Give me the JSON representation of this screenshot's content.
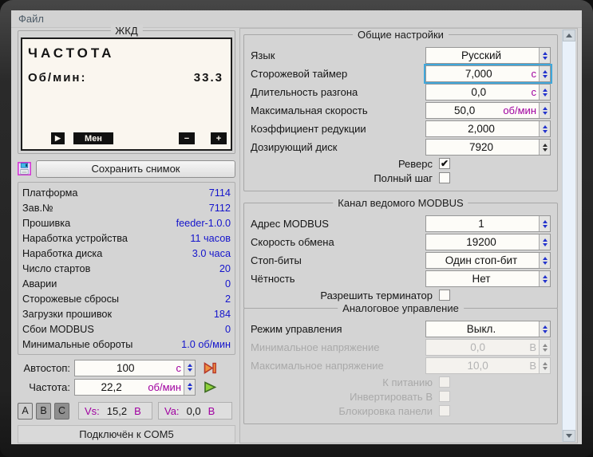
{
  "window": {
    "menu_file": "Файл",
    "status": "Подключён к COM5"
  },
  "lcd": {
    "group_title": "ЖКД",
    "line1": "ЧАСТОТА",
    "line2_label": "Об/мин:",
    "line2_value": "33.3",
    "btn_play": "▶",
    "btn_menu": "Мен",
    "btn_minus": "−",
    "btn_plus": "+"
  },
  "save": {
    "label": "Сохранить снимок"
  },
  "props": {
    "rows": [
      {
        "label": "Платформа",
        "value": "7114"
      },
      {
        "label": "Зав.№",
        "value": "7112"
      },
      {
        "label": "Прошивка",
        "value": "feeder-1.0.0"
      },
      {
        "label": "Наработка устройства",
        "value": "11 часов"
      },
      {
        "label": "Наработка диска",
        "value": "3.0 часа"
      },
      {
        "label": "Число стартов",
        "value": "20"
      },
      {
        "label": "Аварии",
        "value": "0"
      },
      {
        "label": "Сторожевые сбросы",
        "value": "2"
      },
      {
        "label": "Загрузки прошивок",
        "value": "184"
      },
      {
        "label": "Сбои MODBUS",
        "value": "0"
      },
      {
        "label": "Минимальные обороты",
        "value": "1.0 об/мин"
      }
    ]
  },
  "control": {
    "autostop": {
      "label": "Автостоп:",
      "value": "100",
      "suffix": "с"
    },
    "freq": {
      "label": "Частота:",
      "value": "22,2",
      "suffix": "об/мин"
    },
    "abc": {
      "a": "A",
      "b": "B",
      "c": "C"
    },
    "vs": {
      "label": "Vs:",
      "value": "15,2",
      "unit": "В"
    },
    "va": {
      "label": "Va:",
      "value": "0,0",
      "unit": "В"
    }
  },
  "general": {
    "title": "Общие настройки",
    "rows": [
      {
        "label": "Язык",
        "value": "Русский",
        "suffix": ""
      },
      {
        "label": "Сторожевой таймер",
        "value": "7,000",
        "suffix": "с"
      },
      {
        "label": "Длительность разгона",
        "value": "0,0",
        "suffix": "с"
      },
      {
        "label": "Максимальная скорость",
        "value": "50,0",
        "suffix": "об/мин"
      },
      {
        "label": "Коэффициент редукции",
        "value": "2,000",
        "suffix": ""
      },
      {
        "label": "Дозирующий диск",
        "value": "7920",
        "suffix": ""
      }
    ],
    "checks": [
      {
        "label": "Реверс",
        "check": "✔"
      },
      {
        "label": "Полный шаг",
        "check": ""
      }
    ]
  },
  "modbus": {
    "title": "Канал ведомого MODBUS",
    "rows": [
      {
        "label": "Адрес MODBUS",
        "value": "1",
        "suffix": ""
      },
      {
        "label": "Скорость обмена",
        "value": "19200",
        "suffix": ""
      },
      {
        "label": "Стоп-биты",
        "value": "Один стоп-бит",
        "suffix": ""
      },
      {
        "label": "Чётность",
        "value": "Нет",
        "suffix": ""
      }
    ],
    "checks": [
      {
        "label": "Разрешить терминатор",
        "check": ""
      }
    ]
  },
  "analog": {
    "title": "Аналоговое управление",
    "rows": [
      {
        "label": "Режим управления",
        "value": "Выкл.",
        "suffix": ""
      },
      {
        "label": "Минимальное напряжение",
        "value": "0,0",
        "suffix": "В"
      },
      {
        "label": "Максимальное напряжение",
        "value": "10,0",
        "suffix": "В"
      }
    ],
    "checks": [
      {
        "label": "К питанию",
        "check": ""
      },
      {
        "label": "Инвертировать В",
        "check": ""
      },
      {
        "label": "Блокировка панели",
        "check": ""
      }
    ]
  },
  "colors": {
    "value_blue": "#1414cc",
    "suffix_purple": "#a000a0",
    "focus_cyan": "#3fa7db",
    "lcd_bg": "#faf6ef",
    "frame_dark": "#2e2e2e"
  }
}
